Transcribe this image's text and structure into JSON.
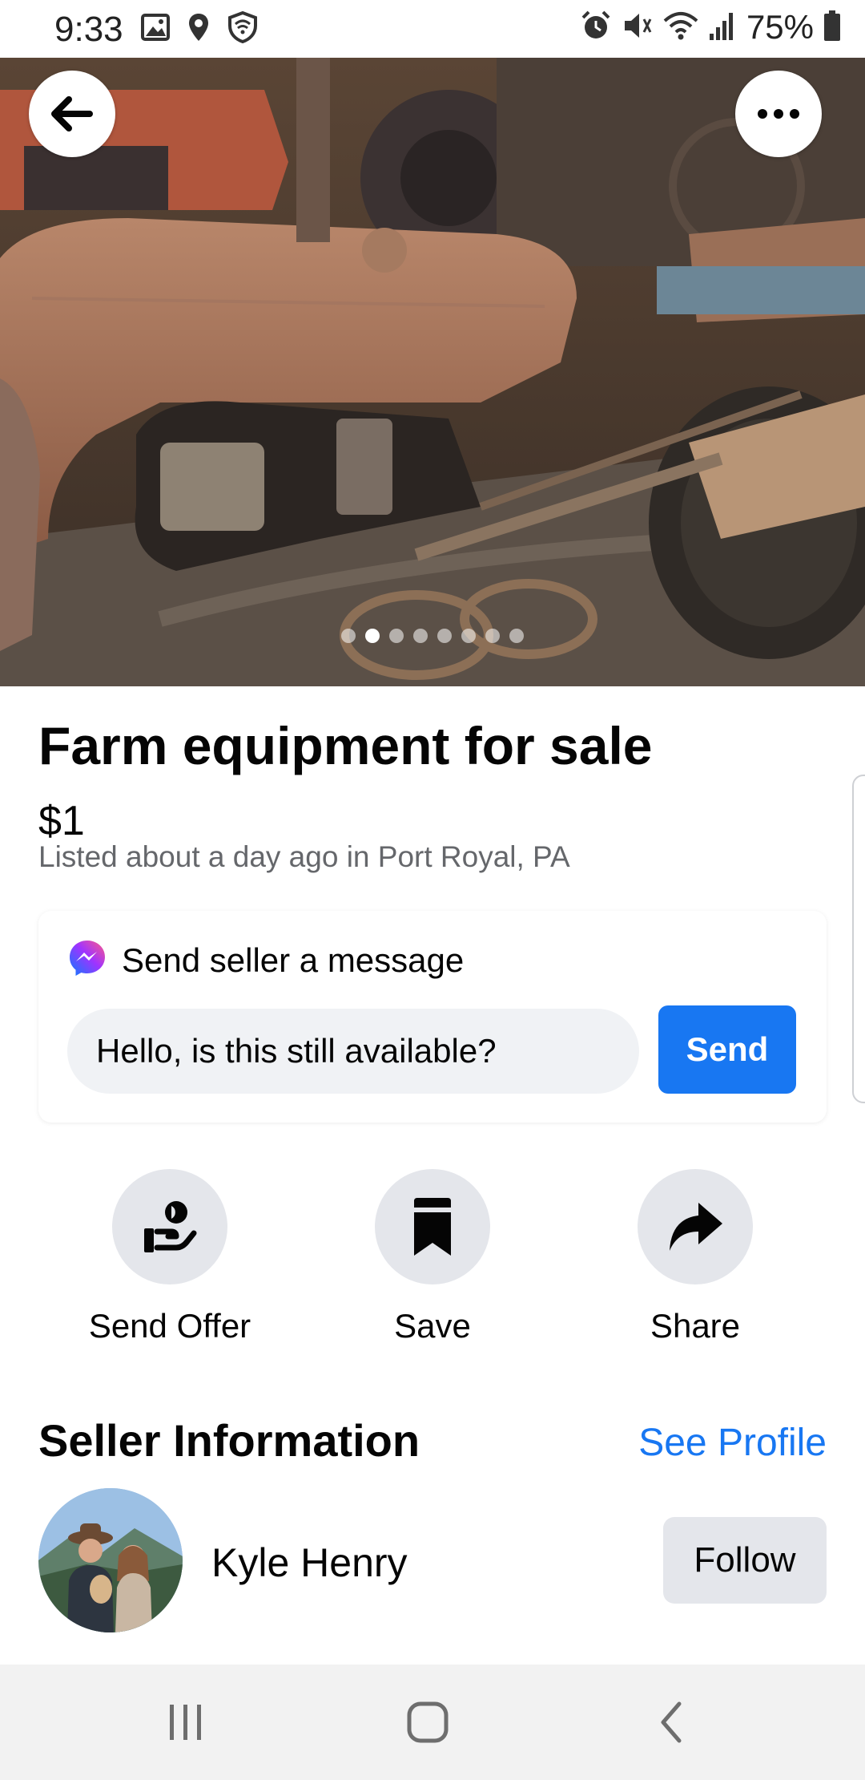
{
  "status_bar": {
    "time": "9:33",
    "battery": "75%",
    "left_icons": [
      "gallery-icon",
      "location-icon",
      "shield-icon"
    ],
    "right_icons": [
      "alarm-icon",
      "mute-icon",
      "wifi-icon",
      "signal-icon",
      "battery-icon"
    ]
  },
  "hero": {
    "image_count": 8,
    "active_index": 1
  },
  "listing": {
    "title": "Farm equipment for sale",
    "price": "$1",
    "meta": "Listed about a day ago in Port Royal, PA"
  },
  "message": {
    "header": "Send seller a message",
    "input_value": "Hello, is this still available?",
    "send_label": "Send"
  },
  "actions": [
    {
      "label": "Send Offer",
      "icon": "offer-icon"
    },
    {
      "label": "Save",
      "icon": "bookmark-icon"
    },
    {
      "label": "Share",
      "icon": "share-icon"
    }
  ],
  "seller": {
    "section_title": "Seller Information",
    "see_profile": "See Profile",
    "name": "Kyle Henry",
    "follow_label": "Follow"
  },
  "colors": {
    "accent": "#1877f2",
    "secondary_button": "#e4e6eb",
    "muted_text": "#65676b"
  }
}
